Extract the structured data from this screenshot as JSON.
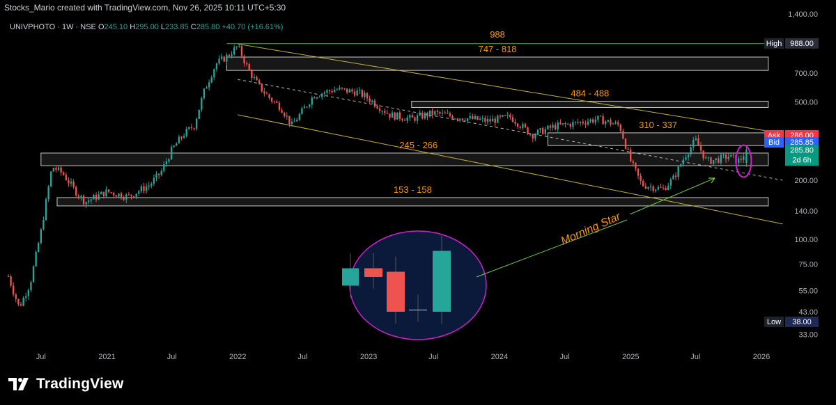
{
  "header": {
    "credit": "Stocks_Mario created with TradingView.com, Nov 26, 2025 10:11 UTC+5:30",
    "symbol": "UNIVPHOTO · 1W · NSE",
    "o_label": "O",
    "o_value": "245.10",
    "h_label": "H",
    "h_value": "295.00",
    "l_label": "L",
    "l_value": "233.85",
    "c_label": "C",
    "c_value": "285.80",
    "change": "+40.70 (+16.61%)"
  },
  "colors": {
    "up": "#26a69a",
    "down": "#ef5350",
    "zone_label": "#ff9800",
    "channel": "#c8b432",
    "high_line": "#4caf50",
    "annot": "#6fcf3a",
    "circle": "#d020d0",
    "inset_bg": "#0b1a3a"
  },
  "chart_data": {
    "type": "candlestick",
    "y_scale": "log",
    "ylim": [
      30,
      1400
    ],
    "y_ticks": [
      "1,400.00",
      "700.00",
      "500.00",
      "200.00",
      "140.00",
      "100.00",
      "75.00",
      "55.00",
      "43.00",
      "33.00"
    ],
    "y_tick_values": [
      1400,
      700,
      500,
      200,
      140,
      100,
      75,
      55,
      43,
      33
    ],
    "x_range": [
      "2020-04-01",
      "2026-03-10"
    ],
    "x_ticks": [
      {
        "label": "Jul",
        "date": "2020-07-01"
      },
      {
        "label": "2021",
        "date": "2021-01-01"
      },
      {
        "label": "Jul",
        "date": "2021-07-01"
      },
      {
        "label": "2022",
        "date": "2022-01-01"
      },
      {
        "label": "Jul",
        "date": "2022-07-01"
      },
      {
        "label": "2023",
        "date": "2023-01-01"
      },
      {
        "label": "Jul",
        "date": "2023-07-01"
      },
      {
        "label": "2024",
        "date": "2024-01-01"
      },
      {
        "label": "Jul",
        "date": "2024-07-01"
      },
      {
        "label": "2025",
        "date": "2025-01-01"
      },
      {
        "label": "Jul",
        "date": "2025-07-01"
      },
      {
        "label": "2026",
        "date": "2026-01-01"
      }
    ],
    "price_path": [
      [
        "2020-04-01",
        65
      ],
      [
        "2020-05-01",
        45
      ],
      [
        "2020-06-01",
        60
      ],
      [
        "2020-07-01",
        110
      ],
      [
        "2020-08-01",
        235
      ],
      [
        "2020-09-01",
        215
      ],
      [
        "2020-10-01",
        180
      ],
      [
        "2020-11-01",
        155
      ],
      [
        "2021-01-01",
        175
      ],
      [
        "2021-03-01",
        165
      ],
      [
        "2021-05-01",
        190
      ],
      [
        "2021-06-01",
        220
      ],
      [
        "2021-07-01",
        285
      ],
      [
        "2021-08-01",
        340
      ],
      [
        "2021-09-01",
        380
      ],
      [
        "2021-10-01",
        580
      ],
      [
        "2021-11-01",
        780
      ],
      [
        "2021-12-01",
        850
      ],
      [
        "2022-01-01",
        960
      ],
      [
        "2022-02-01",
        720
      ],
      [
        "2022-03-01",
        600
      ],
      [
        "2022-04-01",
        520
      ],
      [
        "2022-05-01",
        470
      ],
      [
        "2022-06-01",
        380
      ],
      [
        "2022-08-01",
        540
      ],
      [
        "2022-10-01",
        580
      ],
      [
        "2022-12-01",
        560
      ],
      [
        "2023-01-01",
        520
      ],
      [
        "2023-03-01",
        430
      ],
      [
        "2023-05-01",
        410
      ],
      [
        "2023-07-01",
        440
      ],
      [
        "2023-09-01",
        420
      ],
      [
        "2023-12-01",
        400
      ],
      [
        "2024-02-01",
        420
      ],
      [
        "2024-04-01",
        340
      ],
      [
        "2024-06-01",
        375
      ],
      [
        "2024-08-01",
        390
      ],
      [
        "2024-10-01",
        410
      ],
      [
        "2024-12-01",
        380
      ],
      [
        "2025-01-01",
        250
      ],
      [
        "2025-02-01",
        190
      ],
      [
        "2025-04-01",
        180
      ],
      [
        "2025-05-01",
        205
      ],
      [
        "2025-06-01",
        265
      ],
      [
        "2025-07-01",
        320
      ],
      [
        "2025-08-01",
        250
      ],
      [
        "2025-09-01",
        255
      ],
      [
        "2025-10-01",
        265
      ],
      [
        "2025-11-01",
        250
      ],
      [
        "2025-11-20",
        285.8
      ]
    ],
    "last_bar": {
      "open": 245.1,
      "high": 295.0,
      "low": 233.85,
      "close": 285.8
    },
    "zones": [
      {
        "label": "747 - 818",
        "low": 747,
        "high": 818,
        "from": "2021-12-01",
        "to": "2026-01-20"
      },
      {
        "label": "484 - 488",
        "low": 484,
        "high": 488,
        "from": "2023-05-01",
        "to": "2026-01-20"
      },
      {
        "label": "310 - 337",
        "low": 310,
        "high": 337,
        "from": "2024-05-15",
        "to": "2026-01-20"
      },
      {
        "label": "245 - 266",
        "low": 245,
        "high": 266,
        "from": "2020-07-01",
        "to": "2026-01-20"
      },
      {
        "label": "153 - 158",
        "low": 153,
        "high": 158,
        "from": "2020-08-15",
        "to": "2026-01-20"
      }
    ],
    "high_line": {
      "label": "988",
      "value": 988,
      "from": "2021-12-01",
      "to": "2026-01-20"
    },
    "channel_upper": [
      [
        "2022-01-01",
        985
      ],
      [
        "2026-01-20",
        355
      ]
    ],
    "channel_lower": [
      [
        "2022-01-01",
        430
      ],
      [
        "2026-03-01",
        120
      ]
    ],
    "mid_trend": [
      [
        "2022-01-01",
        650
      ],
      [
        "2026-03-01",
        200
      ]
    ],
    "annotation": {
      "text": "Morning Star"
    },
    "inset_candles": [
      {
        "type": "up",
        "open": 3,
        "close": 5
      },
      {
        "type": "down",
        "open": 5,
        "close": 4
      },
      {
        "type": "down",
        "open": 4.6,
        "close": 0
      },
      {
        "type": "doji",
        "open": 0.2,
        "close": 0.2
      },
      {
        "type": "up",
        "open": 0,
        "close": 7
      }
    ],
    "price_labels": {
      "high_label": "High",
      "high_value": "988.00",
      "ask_label": "Ask",
      "ask_value": "286.00",
      "bid_label": "Bid",
      "bid_value": "285.85",
      "last_value": "285.80",
      "countdown": "2d 6h",
      "low_label": "Low",
      "low_value": "38.00"
    }
  },
  "footer": {
    "brand": "TradingView"
  }
}
